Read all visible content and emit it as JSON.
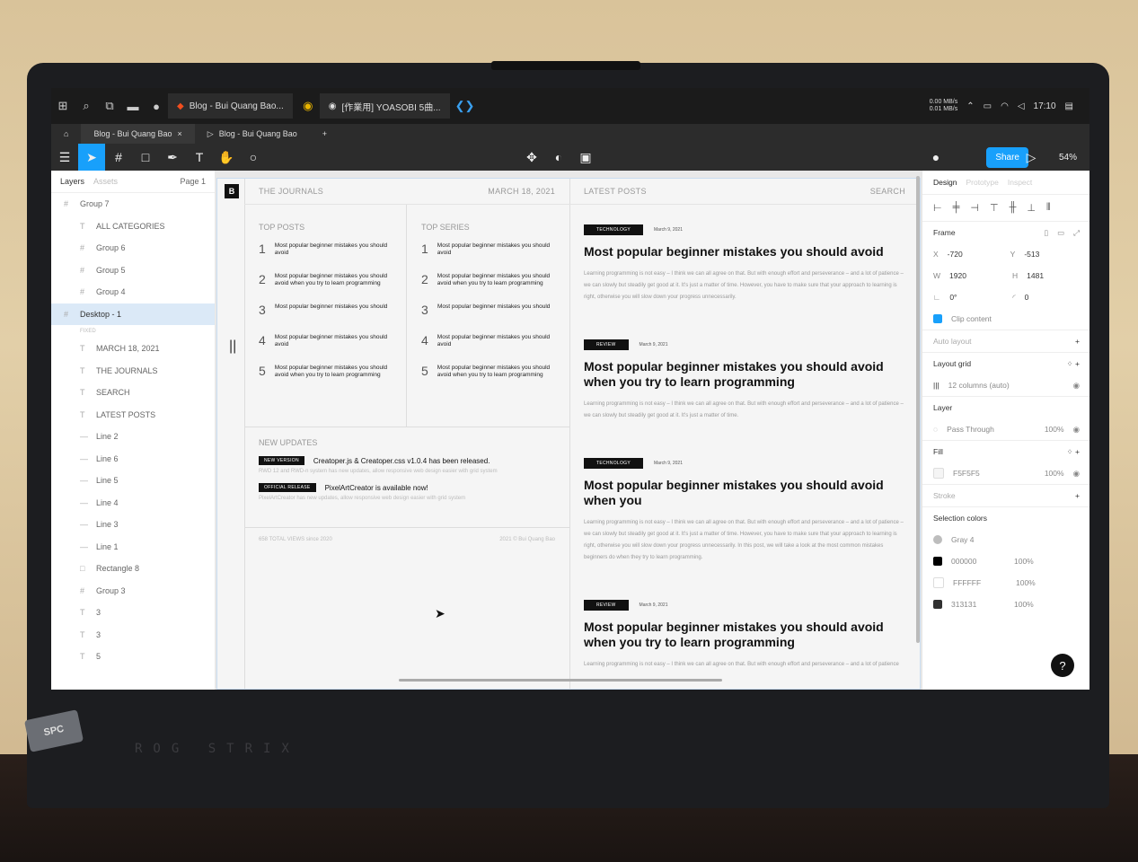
{
  "taskbar": {
    "tabs": [
      "Blog - Bui Quang Bao...",
      "[作業用] YOASOBI 5曲..."
    ],
    "net_up": "0.00 MB/s",
    "net_down": "0.01 MB/s",
    "clock": "17:10"
  },
  "figma_tabs": [
    "Blog - Bui Quang Bao",
    "Blog - Bui Quang Bao"
  ],
  "toolbar": {
    "share_label": "Share",
    "zoom": "54%"
  },
  "left_panel": {
    "tabs": [
      "Layers",
      "Assets"
    ],
    "page": "Page 1",
    "fixed_label": "FIXED",
    "layers_top": [
      {
        "name": "Group 7",
        "icon": "#"
      },
      {
        "name": "ALL CATEGORIES",
        "icon": "T"
      },
      {
        "name": "Group 6",
        "icon": "#"
      },
      {
        "name": "Group 5",
        "icon": "#"
      },
      {
        "name": "Group 4",
        "icon": "#"
      },
      {
        "name": "Desktop - 1",
        "icon": "#"
      }
    ],
    "layers_bottom": [
      {
        "name": "MARCH 18, 2021",
        "icon": "T"
      },
      {
        "name": "THE JOURNALS",
        "icon": "T"
      },
      {
        "name": "SEARCH",
        "icon": "T"
      },
      {
        "name": "LATEST POSTS",
        "icon": "T"
      },
      {
        "name": "Line 2",
        "icon": "—"
      },
      {
        "name": "Line 6",
        "icon": "—"
      },
      {
        "name": "Line 5",
        "icon": "—"
      },
      {
        "name": "Line 4",
        "icon": "—"
      },
      {
        "name": "Line 3",
        "icon": "—"
      },
      {
        "name": "Line 1",
        "icon": "—"
      },
      {
        "name": "Rectangle 8",
        "icon": "□"
      },
      {
        "name": "Group 3",
        "icon": "#"
      },
      {
        "name": "3",
        "icon": "T"
      },
      {
        "name": "3",
        "icon": "T"
      },
      {
        "name": "5",
        "icon": "T"
      }
    ]
  },
  "design": {
    "logo": "B",
    "header_left": "THE JOURNALS",
    "header_date": "MARCH 18, 2021",
    "header_latest": "LATEST POSTS",
    "header_search": "SEARCH",
    "top_posts_title": "TOP POSTS",
    "top_series_title": "TOP SERIES",
    "top_posts": [
      {
        "n": "1",
        "t": "Most popular beginner mistakes you should avoid"
      },
      {
        "n": "2",
        "t": "Most popular beginner mistakes you should avoid when you try to learn programming"
      },
      {
        "n": "3",
        "t": "Most popular beginner mistakes you should"
      },
      {
        "n": "4",
        "t": "Most popular beginner mistakes you should avoid"
      },
      {
        "n": "5",
        "t": "Most popular beginner mistakes you should avoid when you try to learn programming"
      }
    ],
    "top_series": [
      {
        "n": "1",
        "t": "Most popular beginner mistakes you should avoid"
      },
      {
        "n": "2",
        "t": "Most popular beginner mistakes you should avoid when you try to learn programming"
      },
      {
        "n": "3",
        "t": "Most popular beginner mistakes you should"
      },
      {
        "n": "4",
        "t": "Most popular beginner mistakes you should avoid"
      },
      {
        "n": "5",
        "t": "Most popular beginner mistakes you should avoid when you try to learn programming"
      }
    ],
    "updates_title": "NEW UPDATES",
    "updates": [
      {
        "tag": "NEW VERSION",
        "title": "Creatoper.js & Creatoper.css v1.0.4 has been released.",
        "desc": "RWD 12 and RWD-n system has new updates, allow responsive web design easier with grid system"
      },
      {
        "tag": "OFFICIAL RELEASE",
        "title": "PixelArtCreator is available now!",
        "desc": "PixelArtCreator has new updates, allow responsive web design easier with grid system"
      }
    ],
    "footer_views": "658 TOTAL VIEWS since 2020",
    "footer_copy": "2021 © Bui Quang Bao",
    "articles": [
      {
        "tag": "TECHNOLOGY",
        "date": "March 9, 2021",
        "title": "Most popular beginner mistakes you should avoid",
        "excerpt": "Learning programming is not easy – I think we can all agree on that. But with enough effort and perseverance – and a lot of patience – we can slowly but steadily get good at it. It's just a matter of time. However, you have to make sure that your approach to learning is right, otherwise you will slow down your progress unnecessarily."
      },
      {
        "tag": "REVIEW",
        "date": "March 9, 2021",
        "title": "Most popular beginner mistakes you should avoid when you try to learn programming",
        "excerpt": "Learning programming is not easy – I think we can all agree on that. But with enough effort and perseverance – and a lot of patience – we can slowly but steadily get good at it. It's just a matter of time."
      },
      {
        "tag": "TECHNOLOGY",
        "date": "March 9, 2021",
        "title": "Most popular beginner mistakes you should avoid when you",
        "excerpt": "Learning programming is not easy – I think we can all agree on that. But with enough effort and perseverance – and a lot of patience – we can slowly but steadily get good at it. It's just a matter of time. However, you have to make sure that your approach to learning is right, otherwise you will slow down your progress unnecessarily. In this post, we will take a look at the most common mistakes beginners do when they try to learn programming."
      },
      {
        "tag": "REVIEW",
        "date": "March 9, 2021",
        "title": "Most popular beginner mistakes you should avoid when you try to learn programming",
        "excerpt": "Learning programming is not easy – I think we can all agree on that. But with enough effort and perseverance – and a lot of patience"
      }
    ]
  },
  "right_panel": {
    "tabs": [
      "Design",
      "Prototype",
      "Inspect"
    ],
    "frame_label": "Frame",
    "x": "-720",
    "y": "-513",
    "w": "1920",
    "h": "1481",
    "rotation": "0°",
    "radius": "0",
    "clip_content": "Clip content",
    "auto_layout": "Auto layout",
    "layout_grid": "Layout grid",
    "grid_value": "12 columns (auto)",
    "layer": "Layer",
    "blend": "Pass Through",
    "layer_opacity": "100%",
    "fill": "Fill",
    "fill_hex": "F5F5F5",
    "fill_opacity": "100%",
    "stroke": "Stroke",
    "selection_colors": "Selection colors",
    "colors": [
      {
        "name": "Gray 4",
        "pct": "",
        "hex": "#bdbdbd"
      },
      {
        "name": "000000",
        "pct": "100%",
        "hex": "#000000"
      },
      {
        "name": "FFFFFF",
        "pct": "100%",
        "hex": "#ffffff"
      },
      {
        "name": "313131",
        "pct": "100%",
        "hex": "#313131"
      }
    ]
  },
  "laptop": {
    "brand": "ROG STRIX",
    "sticker": "SPC"
  }
}
